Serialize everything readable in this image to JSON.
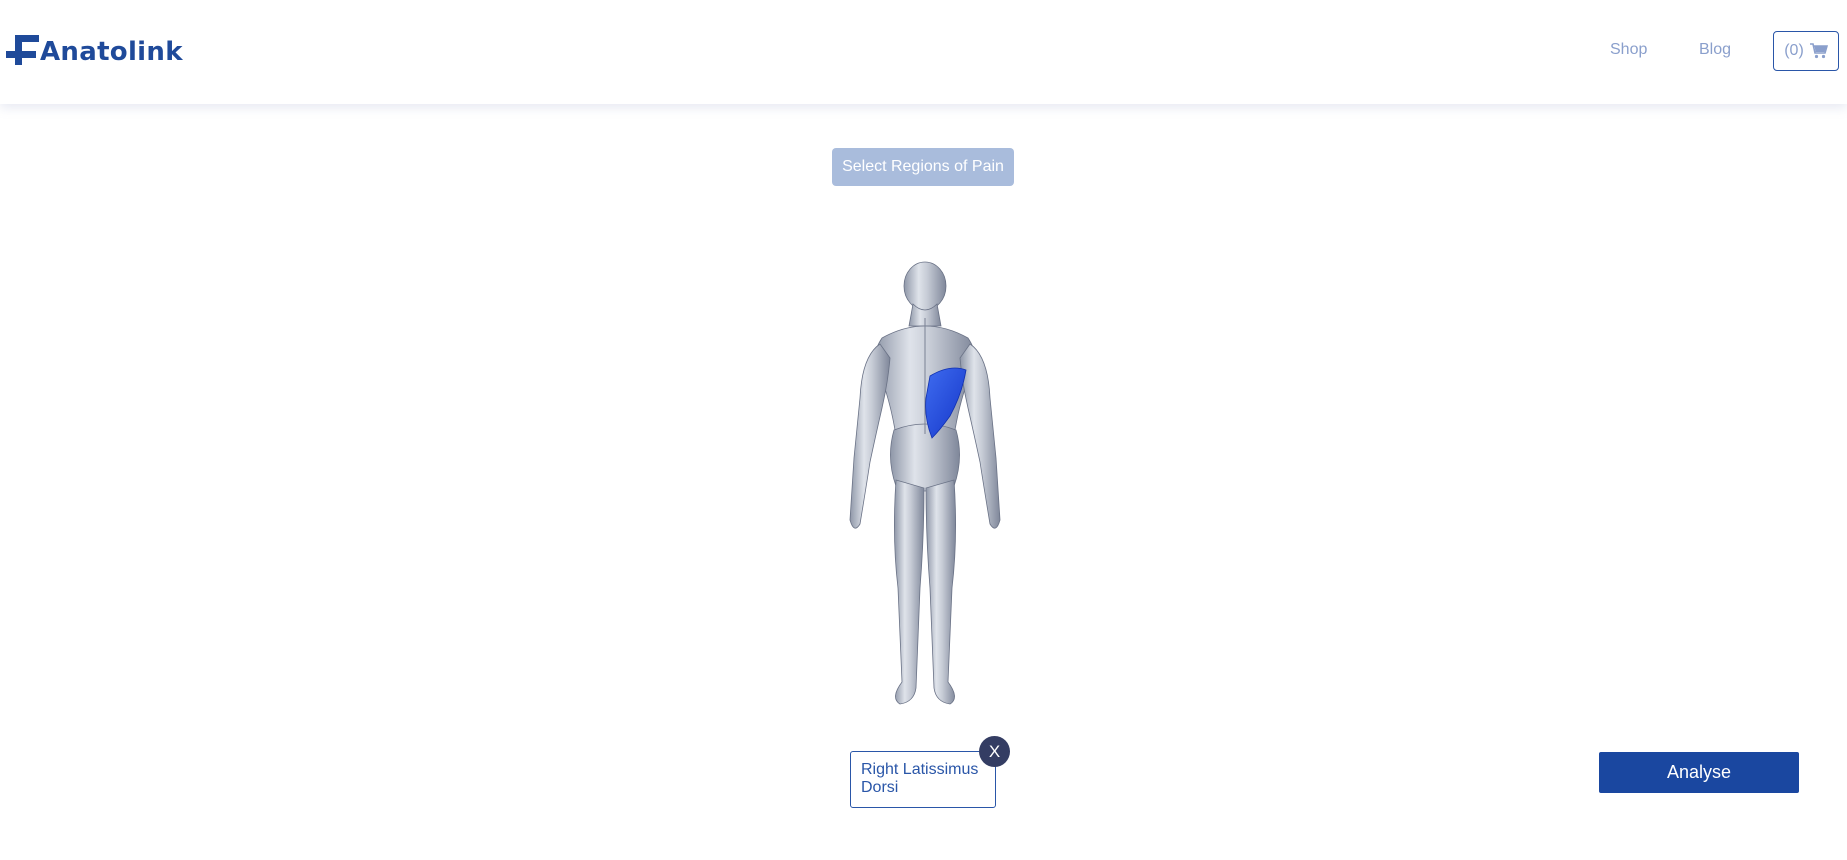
{
  "brand": {
    "name": "Anatolink",
    "color": "#1f4a9a"
  },
  "nav": {
    "shop_label": "Shop",
    "blog_label": "Blog",
    "cart_count": "(0)",
    "cart_icon": "cart-icon"
  },
  "selector": {
    "label": "Select Regions of Pain"
  },
  "body_model": {
    "view": "posterior",
    "highlighted_region": "Right Latissimus Dorsi",
    "highlight_color": "#1f4fe0"
  },
  "selected_regions": [
    {
      "label": "Right Latissimus Dorsi",
      "remove_label": "X"
    }
  ],
  "actions": {
    "analyse_label": "Analyse"
  }
}
